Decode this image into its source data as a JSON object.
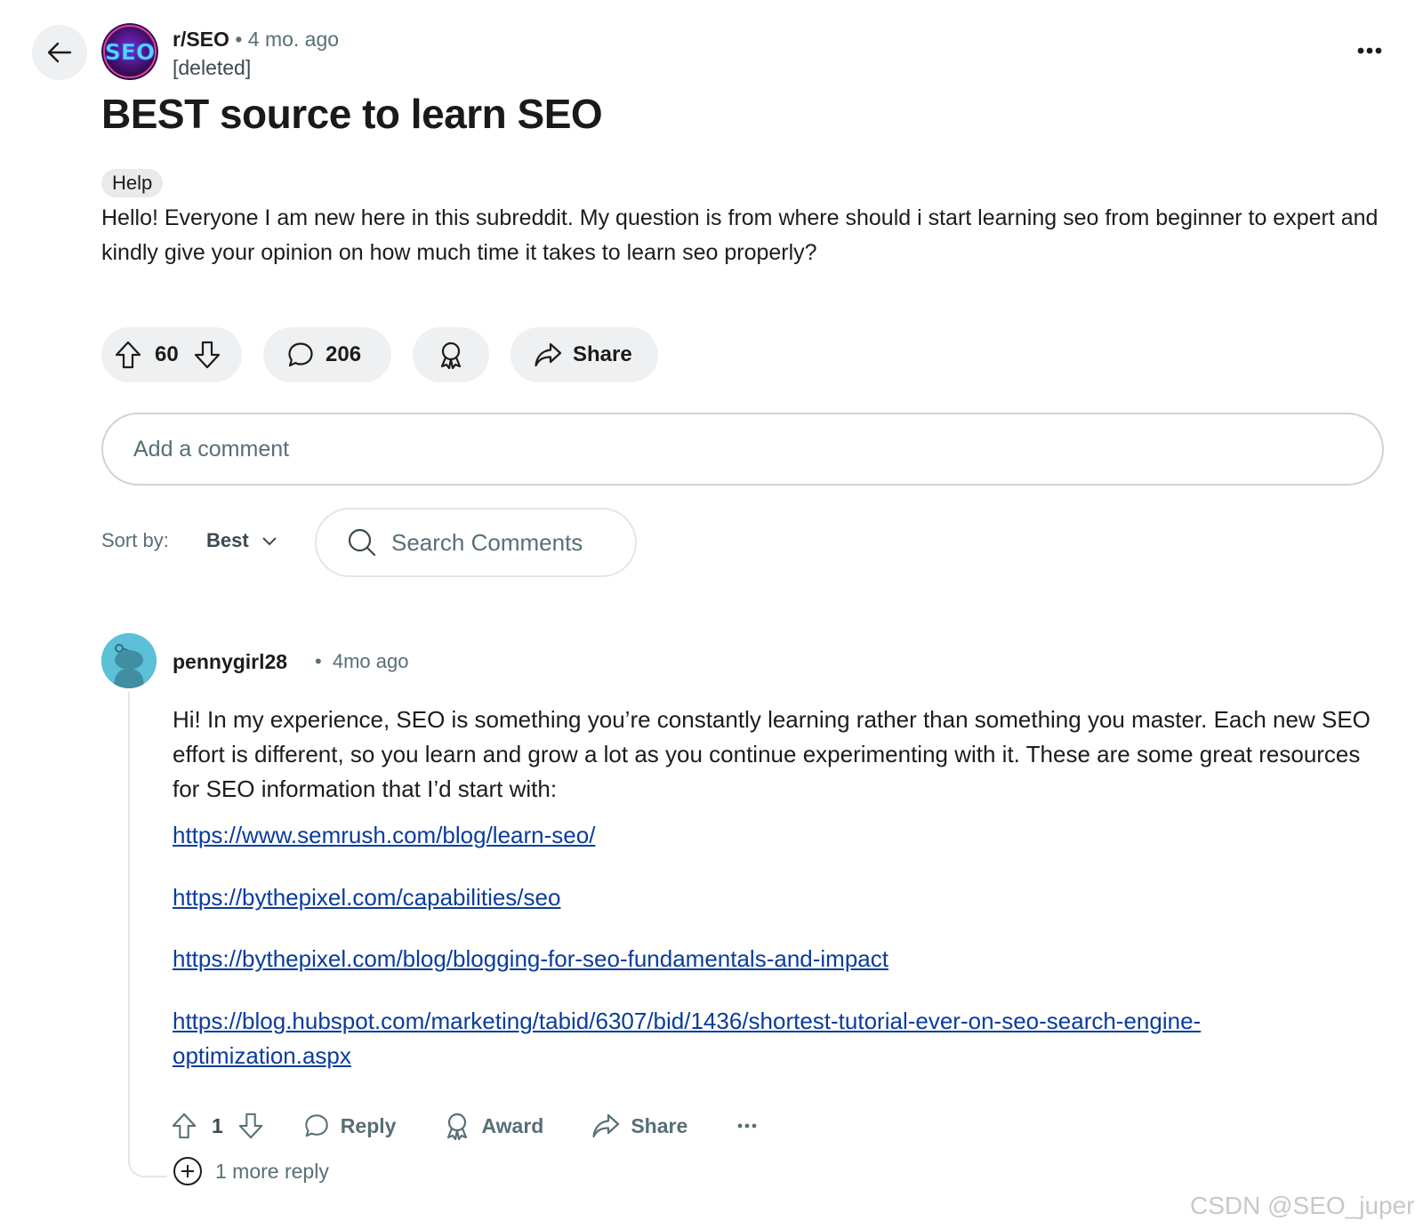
{
  "post": {
    "subreddit": "r/SEO",
    "separator": "•",
    "time": "4 mo. ago",
    "author": "[deleted]",
    "title": "BEST source to learn SEO",
    "flair": "Help",
    "body": "Hello! Everyone I am new here in this subreddit. My question is from where should i start learning seo from beginner to expert and kindly give your opinion on how much time it takes to learn seo properly?",
    "upvotes": "60",
    "comments": "206",
    "share_label": "Share"
  },
  "add_comment_placeholder": "Add a comment",
  "sort": {
    "label": "Sort by:",
    "value": "Best"
  },
  "search_placeholder": "Search Comments",
  "comment": {
    "author": "pennygirl28",
    "separator": "•",
    "time": "4mo ago",
    "body": "Hi! In my experience, SEO is something you’re constantly learning rather than something you master. Each new SEO effort is different, so you learn and grow a lot as you continue experimenting with it. These are some great resources for SEO information that I’d start with:",
    "links": [
      "https://www.semrush.com/blog/learn-seo/",
      "https://bythepixel.com/capabilities/seo",
      "https://bythepixel.com/blog/blogging-for-seo-fundamentals-and-impact",
      "https://blog.hubspot.com/marketing/tabid/6307/bid/1436/shortest-tutorial-ever-on-seo-search-engine-optimization.aspx"
    ],
    "votes": "1",
    "reply_label": "Reply",
    "award_label": "Award",
    "share_label": "Share",
    "more_replies": "1 more reply"
  },
  "watermark": "CSDN @SEO_juper",
  "colors": {
    "link": "#0a3c9e",
    "pill_bg": "#eef0f2",
    "muted_text": "#576f76",
    "subreddit_icon_bg": "#3a0d5c",
    "user_avatar_bg": "#5bc0d8"
  },
  "icons": [
    "back-arrow-icon",
    "subreddit-icon",
    "more-options-icon",
    "upvote-icon",
    "downvote-icon",
    "comment-icon",
    "award-icon",
    "share-icon",
    "search-icon",
    "chevron-down-icon",
    "snoo-avatar-icon",
    "plus-circle-icon"
  ]
}
